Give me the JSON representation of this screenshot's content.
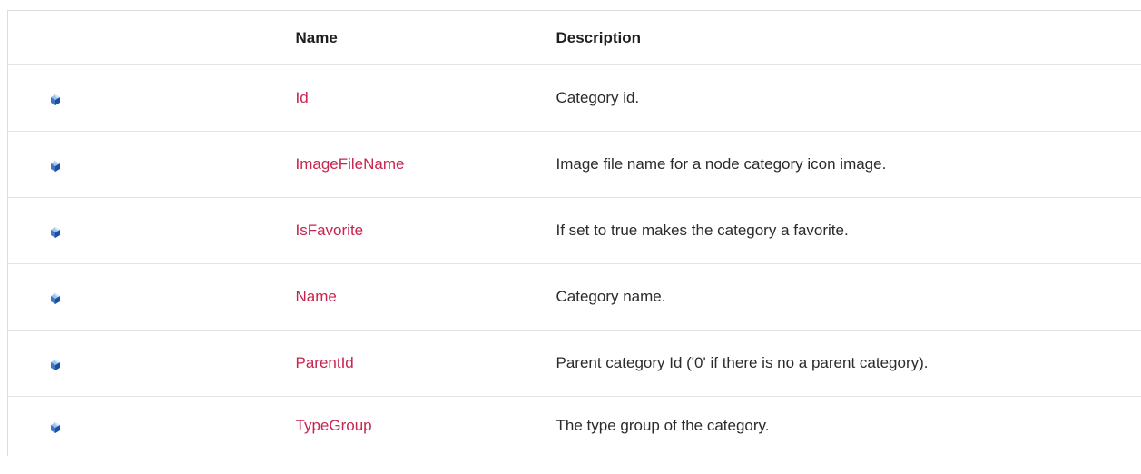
{
  "table": {
    "headers": {
      "icon": "",
      "name": "Name",
      "description": "Description"
    },
    "rows": [
      {
        "icon": "public-property-icon",
        "name": "Id",
        "description": "Category id."
      },
      {
        "icon": "public-property-icon",
        "name": "ImageFileName",
        "description": "Image file name for a node category icon image."
      },
      {
        "icon": "public-property-icon",
        "name": "IsFavorite",
        "description": "If set to true makes the category a favorite."
      },
      {
        "icon": "public-property-icon",
        "name": "Name",
        "description": "Category name."
      },
      {
        "icon": "public-property-icon",
        "name": "ParentId",
        "description": "Parent category Id ('0' if there is no a parent category)."
      },
      {
        "icon": "public-property-icon",
        "name": "TypeGroup",
        "description": "The type group of the category."
      }
    ]
  },
  "colors": {
    "link": "#c7254e",
    "text": "#2b2b2b",
    "border": "#dcdcdc"
  }
}
